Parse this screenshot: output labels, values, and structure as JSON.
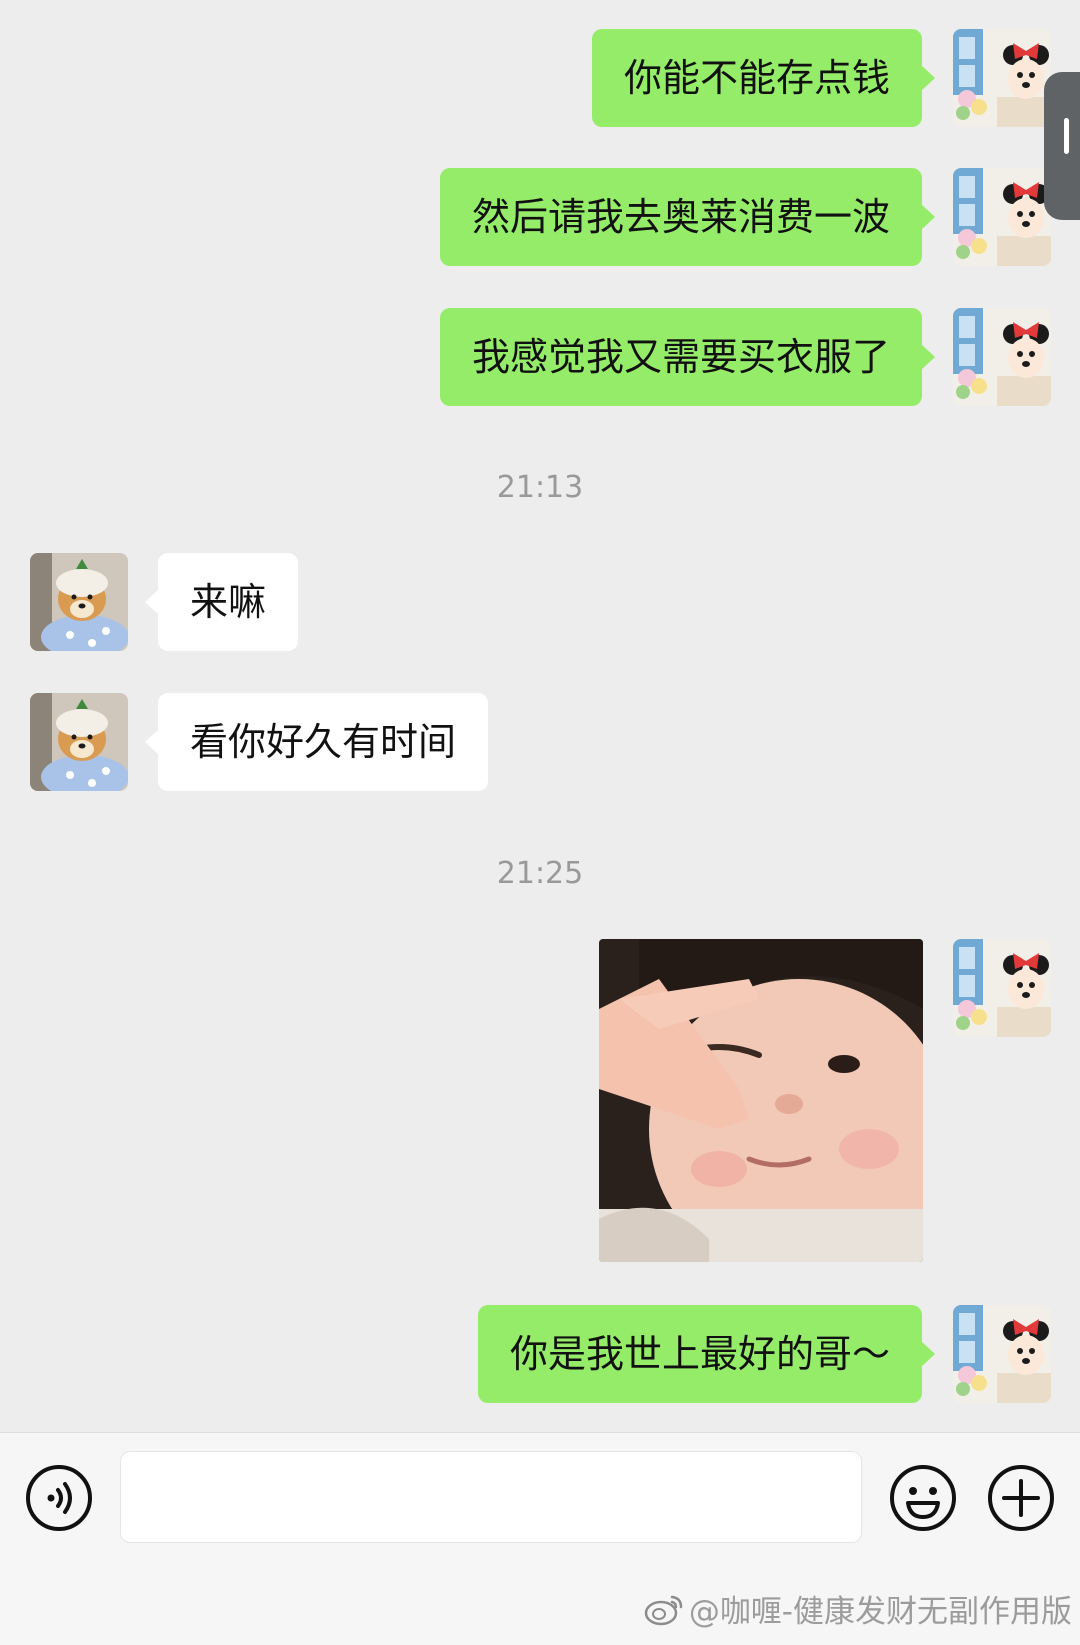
{
  "messages": [
    {
      "side": "me",
      "text": "你能不能存点钱"
    },
    {
      "side": "me",
      "text": "然后请我去奥莱消费一波"
    },
    {
      "side": "me",
      "text": "我感觉我又需要买衣服了"
    },
    {
      "timestamp": "21:13"
    },
    {
      "side": "other",
      "text": "来嘛"
    },
    {
      "side": "other",
      "text": "看你好久有时间"
    },
    {
      "timestamp": "21:25"
    },
    {
      "side": "me",
      "type": "image",
      "description": "sticker"
    },
    {
      "side": "me",
      "text": "你是我世上最好的哥～"
    }
  ],
  "input_bar": {
    "message_value": "",
    "icons": [
      "voice-icon",
      "emoji-icon",
      "plus-icon"
    ]
  },
  "watermark": {
    "text": "@咖喱-健康发财无副作用版"
  },
  "colors": {
    "background": "#ededed",
    "my_bubble": "#95ec69",
    "their_bubble": "#ffffff",
    "timestamp": "#999999"
  }
}
